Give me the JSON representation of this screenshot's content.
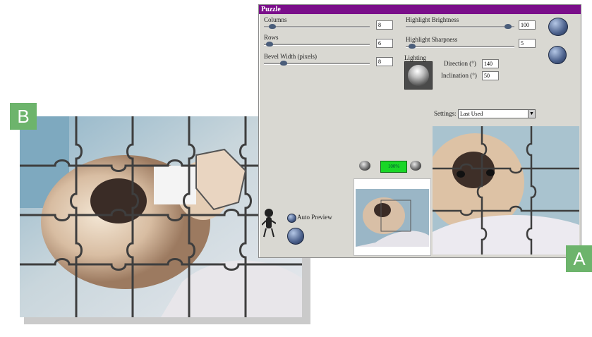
{
  "badges": {
    "a": "A",
    "b": "B"
  },
  "dialog": {
    "title": "Puzzle",
    "sliders": {
      "columns": {
        "label": "Columns",
        "value": "8"
      },
      "rows": {
        "label": "Rows",
        "value": "6"
      },
      "bevel_width": {
        "label": "Bevel Width (pixels)",
        "value": "8"
      },
      "highlight_brightness": {
        "label": "Highlight Brightness",
        "value": "100"
      },
      "highlight_sharpness": {
        "label": "Highlight Sharpness",
        "value": "5"
      }
    },
    "lighting": {
      "label": "Lighting",
      "direction_label": "Direction (°)",
      "direction_value": "140",
      "inclination_label": "Inclination (°)",
      "inclination_value": "50"
    },
    "settings": {
      "label": "Settings:",
      "selected": "Last Used"
    },
    "progress_label": "100%",
    "auto_preview_label": "Auto Preview"
  },
  "colors": {
    "title_bar": "#7a0e8a",
    "dialog_bg": "#d9d8d2",
    "badge_green": "#6db46c",
    "progress_green": "#19d627"
  }
}
